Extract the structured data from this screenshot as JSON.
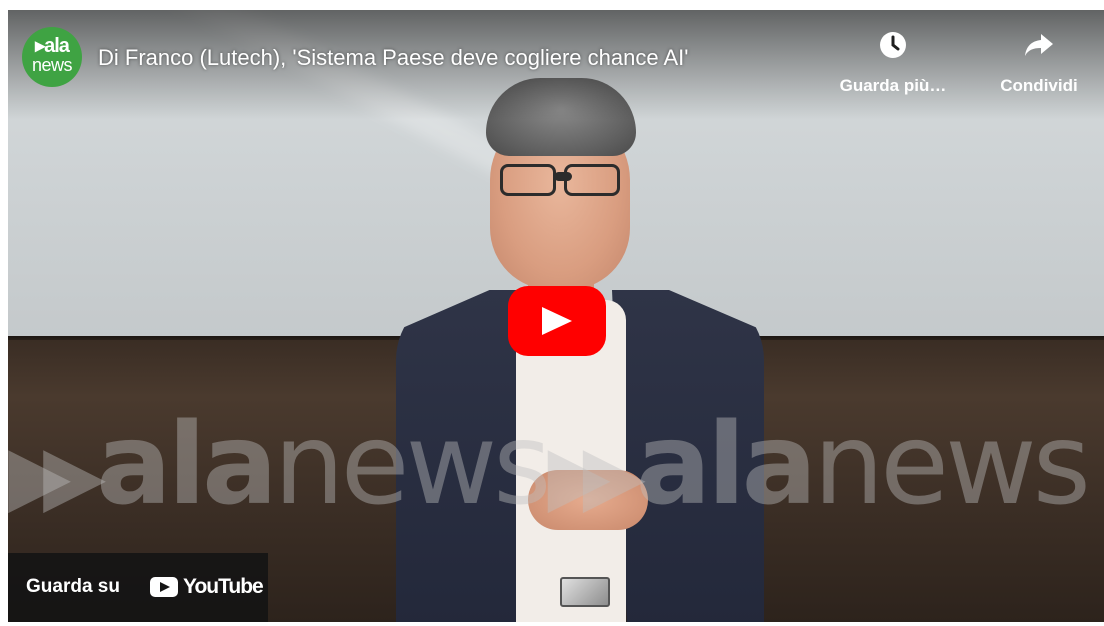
{
  "channel": {
    "logo_line1": "▸ala",
    "logo_line2": "news"
  },
  "video": {
    "title": "Di Franco (Lutech), 'Sistema Paese deve cogliere chance AI'"
  },
  "actions": {
    "watch_later_label": "Guarda più…",
    "share_label": "Condividi"
  },
  "watermark": {
    "segment1_bold": "ala",
    "segment1_light": "news",
    "segment2_bold": "ala",
    "segment2_light": "news"
  },
  "footer": {
    "watch_on_label": "Guarda su",
    "youtube_wordmark": "YouTube"
  },
  "colors": {
    "play_button": "#ff0000",
    "channel_logo_bg": "#3fa343"
  },
  "icons": {
    "watch_later": "clock-icon",
    "share": "share-arrow-icon",
    "play": "play-icon",
    "youtube": "youtube-logo-icon"
  }
}
